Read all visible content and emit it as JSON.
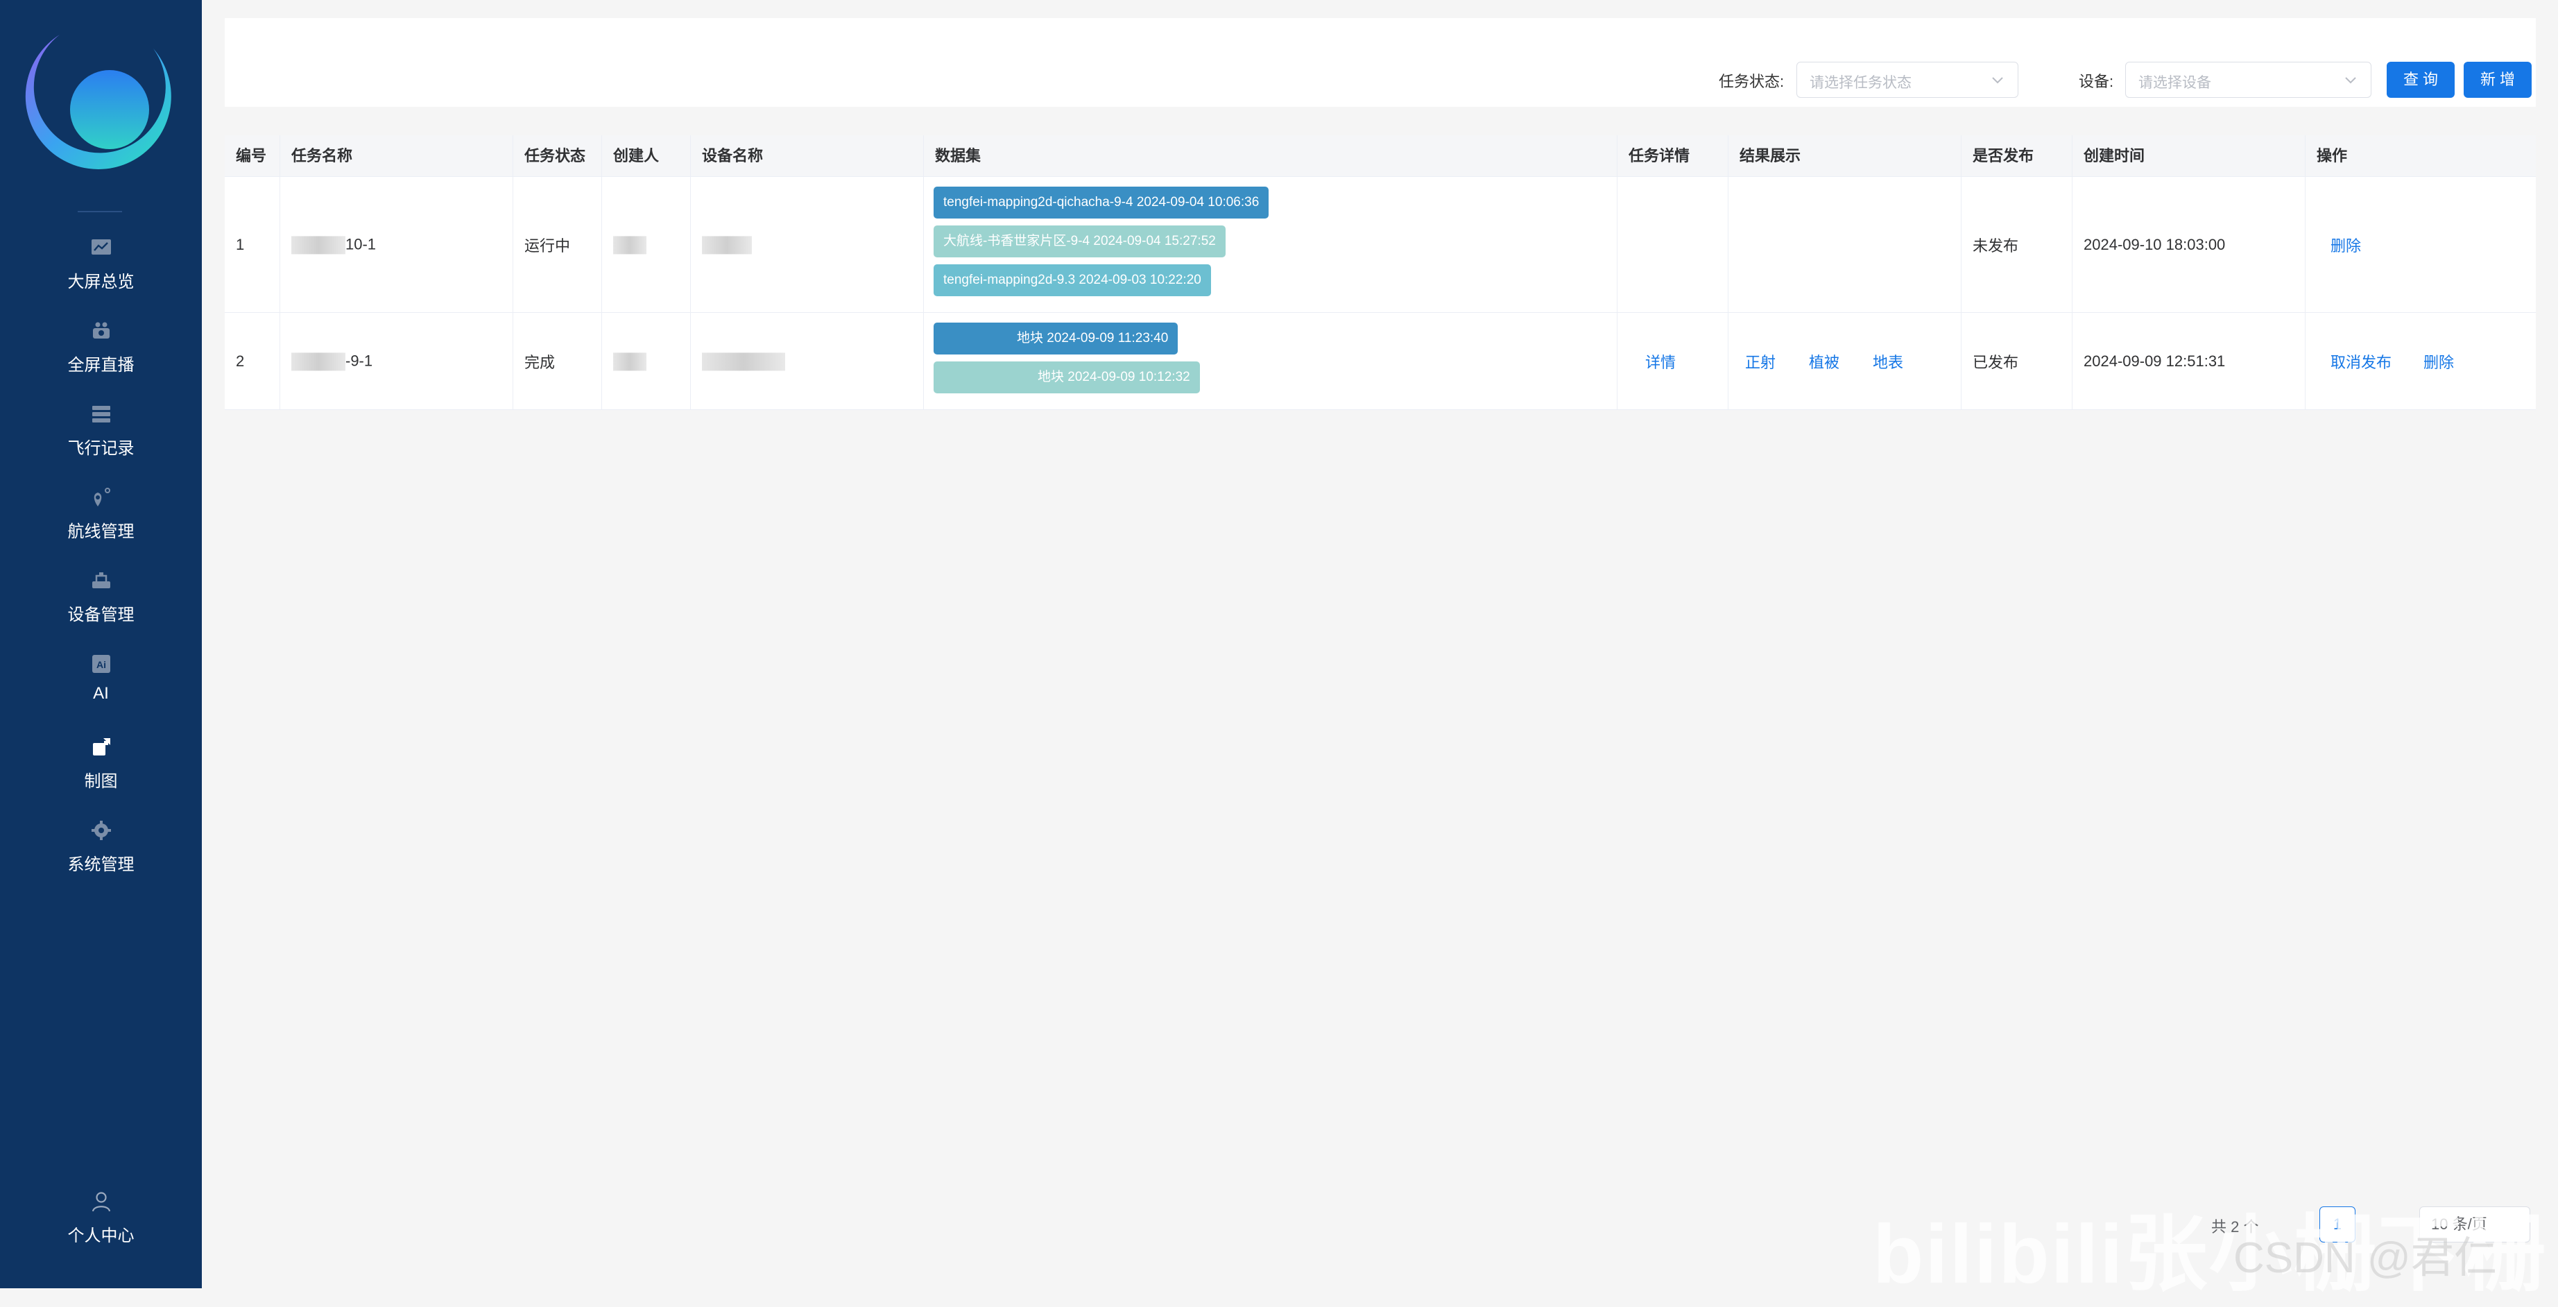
{
  "sidebar": {
    "items": [
      {
        "label": "大屏总览",
        "icon": "chart-screen-icon"
      },
      {
        "label": "全屏直播",
        "icon": "drone-camera-icon"
      },
      {
        "label": "飞行记录",
        "icon": "record-list-icon"
      },
      {
        "label": "航线管理",
        "icon": "route-pin-icon"
      },
      {
        "label": "设备管理",
        "icon": "device-icon"
      },
      {
        "label": "AI",
        "icon": "ai-icon"
      },
      {
        "label": "制图",
        "icon": "mapping-icon"
      },
      {
        "label": "系统管理",
        "icon": "gear-icon"
      }
    ],
    "profile": {
      "label": "个人中心",
      "icon": "user-icon"
    }
  },
  "filters": {
    "status_label": "任务状态:",
    "status_placeholder": "请选择任务状态",
    "device_label": "设备:",
    "device_placeholder": "请选择设备",
    "query_label": "查 询",
    "add_label": "新 增"
  },
  "table": {
    "columns": [
      "编号",
      "任务名称",
      "任务状态",
      "创建人",
      "设备名称",
      "数据集",
      "任务详情",
      "结果展示",
      "是否发布",
      "创建时间",
      "操作"
    ],
    "rows": [
      {
        "id": "1",
        "name_suffix": "10-1",
        "status": "运行中",
        "datasets": [
          "tengfei-mapping2d-qichacha-9-4 2024-09-04 10:06:36",
          "大航线-书香世家片区-9-4 2024-09-04 15:27:52",
          "tengfei-mapping2d-9.3 2024-09-03 10:22:20"
        ],
        "published": "未发布",
        "created": "2024-09-10 18:03:00",
        "actions": [
          "删除"
        ]
      },
      {
        "id": "2",
        "name_suffix": "-9-1",
        "status": "完成",
        "datasets": [
          "地块 2024-09-09 11:23:40",
          "地块 2024-09-09 10:12:32"
        ],
        "detail": "详情",
        "results": [
          "正射",
          "植被",
          "地表"
        ],
        "published": "已发布",
        "created": "2024-09-09 12:51:31",
        "actions": [
          "取消发布",
          "删除"
        ]
      }
    ]
  },
  "pagination": {
    "total": "共 2 个",
    "page": "1",
    "page_size": "10 条/页"
  },
  "watermark": {
    "text": "bilibili张小栅下栅",
    "sub": "CSDN @君仁"
  },
  "colors": {
    "sidebar_bg": "#0e3463",
    "primary": "#1677e6",
    "tag_dark": "#3a8fc4",
    "tag_light": "#9bd3cf",
    "tag_mid": "#6cbfd1"
  }
}
